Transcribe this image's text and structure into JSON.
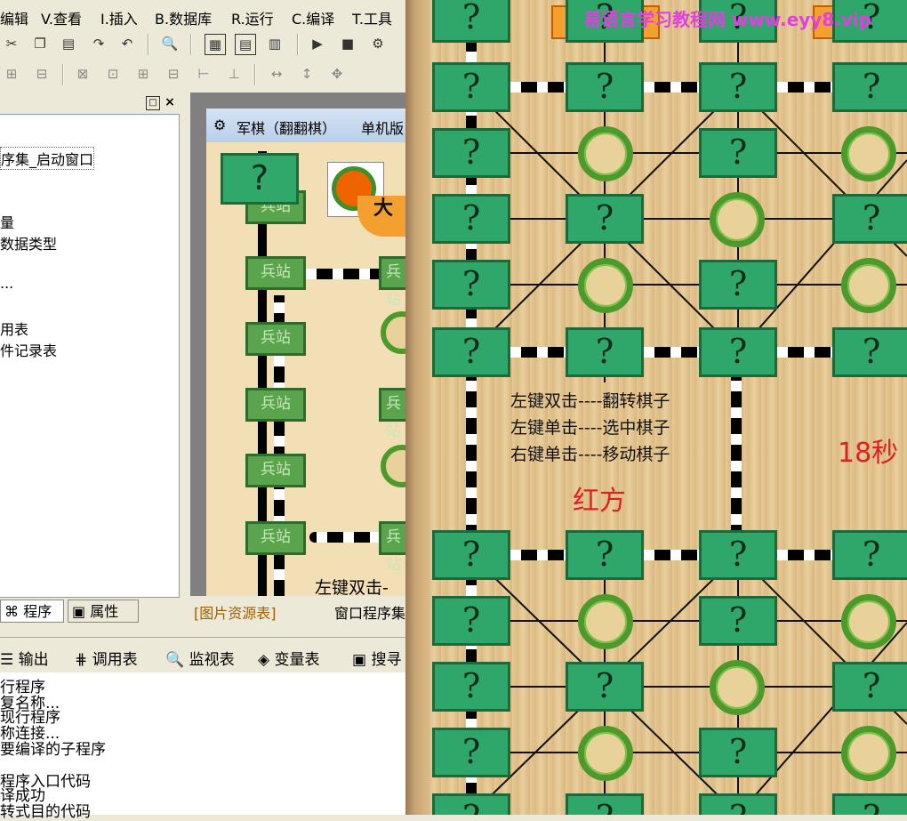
{
  "menubar": {
    "items": [
      "编辑",
      "V.查看",
      "I.插入",
      "B.数据库",
      "R.运行",
      "C.编译",
      "T.工具"
    ],
    "items_prefix": [
      "",
      "V",
      "I",
      "B",
      "R",
      "C",
      "T"
    ]
  },
  "left_panel": {
    "tree": [
      "序集_启动窗口",
      "量",
      "数据类型",
      "...",
      "用表",
      "件记录表"
    ],
    "tabs": [
      "程序",
      "属性"
    ]
  },
  "designer": {
    "form_title": "军棋（翻翻棋）",
    "form_title_mode": "单机版",
    "station_label": "兵站",
    "unknown_label": "?",
    "hint_partial": "左键双击-",
    "big_partial": "大"
  },
  "doc_tabs": [
    "[图片资源表]",
    "窗口程序集"
  ],
  "output_tabs": [
    "输出",
    "调用表",
    "监视表",
    "变量表",
    "搜寻"
  ],
  "output_lines": [
    "行程序",
    "复名称...",
    "现行程序",
    "称连接...",
    "要编译的子程序",
    "程序入口代码",
    "译成功",
    "转式目的代码"
  ],
  "board": {
    "watermark": "易语言学习教程网 www.eyy8.vip",
    "unknown_label": "?",
    "hints": [
      "左键双击----翻转棋子",
      "左键单击----选中棋子",
      "右键单击----移动棋子"
    ],
    "side": "红方",
    "timer": "18秒",
    "colors": {
      "piece": "#2fa66a",
      "piece_border": "#1c6a3c",
      "camp_ring": "#4c9a2a",
      "red_text": "#e02020",
      "watermark": "#e040e0"
    }
  }
}
